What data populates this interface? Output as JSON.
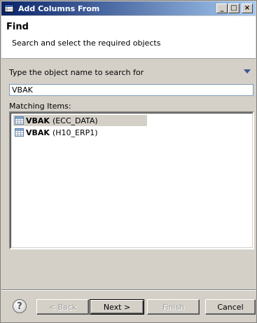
{
  "window": {
    "title": "Add Columns From"
  },
  "titlebar_controls": {
    "minimize": "_",
    "maximize": "□",
    "close": "×"
  },
  "header": {
    "title": "Find",
    "description": "Search and select the required objects"
  },
  "search": {
    "label": "Type the object name to search for",
    "value": "VBAK"
  },
  "matching": {
    "label": "Matching Items:",
    "items": [
      {
        "name": "VBAK",
        "source": "(ECC_DATA)",
        "selected": true
      },
      {
        "name": "VBAK",
        "source": "(H10_ERP1)",
        "selected": false
      }
    ]
  },
  "footer": {
    "help_label": "?",
    "back_label": "< Back",
    "next_label": "Next >",
    "finish_label": "Finish",
    "cancel_label": "Cancel"
  },
  "colors": {
    "title_gradient_start": "#0a246a",
    "title_gradient_end": "#a6caf0",
    "selection": "#d4d0c8",
    "dialog_bg": "#d4d0c8"
  }
}
